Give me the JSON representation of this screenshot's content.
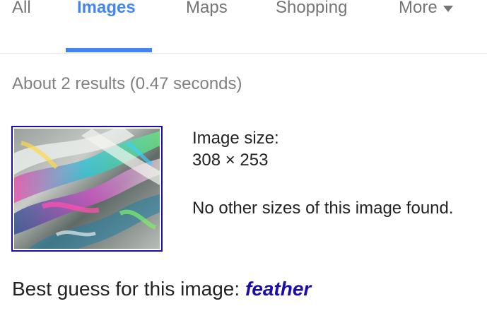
{
  "tabs": {
    "all": "All",
    "images": "Images",
    "maps": "Maps",
    "shopping": "Shopping",
    "more": "More",
    "more_icon": "triangle-down-icon",
    "active": "images",
    "active_color": "#4285f4",
    "inactive_color": "#757575"
  },
  "results": {
    "stats": "About 2 results (0.47 seconds)"
  },
  "image_info": {
    "size_label": "Image size:",
    "size_value": "308 × 253",
    "other_sizes": "No other sizes of this image found."
  },
  "best_guess": {
    "label": "Best guess for this image:",
    "query": "feather",
    "link_color": "#1a0dab"
  }
}
